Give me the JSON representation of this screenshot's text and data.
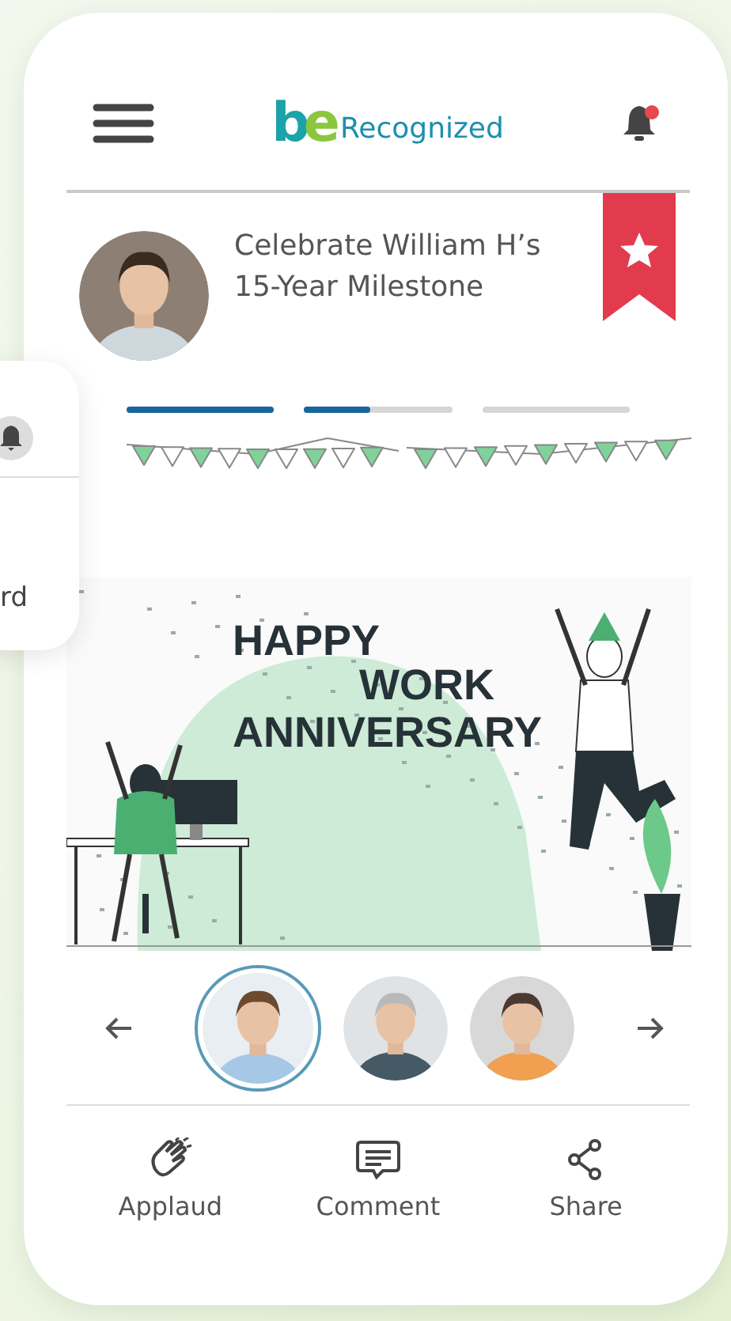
{
  "header": {
    "logo_mark": "be",
    "logo_text": "Recognized",
    "notification_dot": true
  },
  "post": {
    "title_lines": [
      "Celebrate William H’s",
      "15-Year Milestone"
    ],
    "featured": true,
    "progress": [
      {
        "level": 1
      },
      {
        "level": 0.45
      },
      {
        "level": 0
      }
    ],
    "banner_lines": [
      "HAPPY",
      "WORK",
      "ANNIVERSARY"
    ]
  },
  "carousel": {
    "people": [
      {
        "selected": true
      },
      {
        "selected": false
      },
      {
        "selected": false
      }
    ]
  },
  "actions": [
    {
      "kind": "applaud",
      "label": "Applaud"
    },
    {
      "kind": "comment",
      "label": "Comment"
    },
    {
      "kind": "share",
      "label": "Share"
    }
  ],
  "side_card": {
    "text": "rd"
  }
}
